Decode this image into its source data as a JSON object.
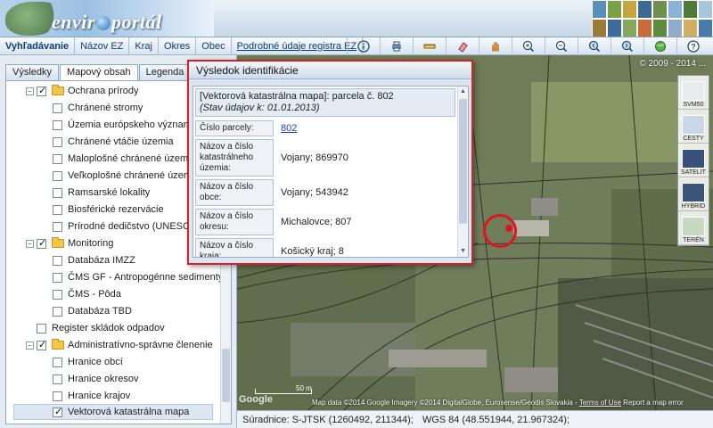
{
  "app": {
    "logo_text_pre": "envir",
    "logo_text_post": "portál"
  },
  "toolbar": {
    "nav": [
      {
        "label": "Vyhľadávanie"
      },
      {
        "label": "Názov EZ"
      },
      {
        "label": "Kraj"
      },
      {
        "label": "Okres"
      },
      {
        "label": "Obec"
      },
      {
        "label": "Podrobné údaje registra EZ"
      }
    ],
    "tools": [
      "info-icon",
      "print-icon",
      "measure-icon",
      "eraser-icon",
      "pan-hand-icon",
      "zoom-in-icon",
      "zoom-out-icon",
      "zoom-prev-icon",
      "zoom-next-icon",
      "full-extent-icon",
      "help-icon"
    ]
  },
  "left_panel": {
    "tabs": [
      {
        "label": "Výsledky",
        "active": false
      },
      {
        "label": "Mapový obsah",
        "active": true
      },
      {
        "label": "Legenda",
        "active": false
      }
    ],
    "tree": [
      {
        "label": "Ochrana prírody",
        "group": true,
        "checked": true
      },
      {
        "label": "Chránené stromy",
        "checked": false
      },
      {
        "label": "Územia európskeho významu",
        "checked": false
      },
      {
        "label": "Chránené vtáčie územia",
        "checked": false
      },
      {
        "label": "Maloplošné chránené územia",
        "checked": false
      },
      {
        "label": "Veľkoplošné chránené územia",
        "checked": false
      },
      {
        "label": "Ramsarské lokality",
        "checked": false
      },
      {
        "label": "Biosférické rezervácie",
        "checked": false
      },
      {
        "label": "Prírodné dedičstvo (UNESCO)",
        "checked": false
      },
      {
        "label": "Monitoring",
        "group": true,
        "checked": true
      },
      {
        "label": "Databáza IMZZ",
        "checked": false
      },
      {
        "label": "ČMS GF - Antropogénne sedimenty",
        "checked": false
      },
      {
        "label": "ČMS - Pôda",
        "checked": false
      },
      {
        "label": "Databáza TBD",
        "checked": false
      },
      {
        "label": "Register skládok odpadov",
        "top": true,
        "checked": false
      },
      {
        "label": "Administratívno-správne členenie",
        "group": true,
        "checked": true
      },
      {
        "label": "Hranice obcí",
        "checked": false
      },
      {
        "label": "Hranice okresov",
        "checked": false
      },
      {
        "label": "Hranice krajov",
        "checked": false
      },
      {
        "label": "Vektorová katastrálna mapa",
        "checked": true,
        "selected": true
      }
    ]
  },
  "map": {
    "copyright": "© 2009 - 2014 ...",
    "map_types": [
      {
        "label": "SVM50",
        "color": "#e8ecef"
      },
      {
        "label": "CESTY",
        "color": "#c9d7e8"
      },
      {
        "label": "SATELIT",
        "color": "#39507a"
      },
      {
        "label": "HYBRID",
        "color": "#3c5479"
      },
      {
        "label": "TERÉN",
        "color": "#c7d8c2"
      }
    ],
    "google_logo": "Google",
    "scale_label": "50 m",
    "attribution_text": "Map data ©2014 Google Imagery ©2014 DigitalGlobe, Eurosense/Geodis Slovakia - ",
    "attribution_terms": "Terms of Use",
    "attribution_report": "Report a map error"
  },
  "statusbar": {
    "sjtsk": "Súradnice: S-JTSK (1260492, 211344);",
    "wgs": "WGS 84 (48.551944, 21.967324);"
  },
  "dialog": {
    "title": "Výsledok identifikácie",
    "header_line": "[Vektorová katastrálna mapa]: parcela č. 802",
    "header_stav": "(Stav údajov k: 01.01.2013)",
    "rows": [
      {
        "label": "Číslo parcely:",
        "value": "802",
        "link": true
      },
      {
        "label": "Názov a číslo katastrálneho územia:",
        "value": "Vojany; 869970"
      },
      {
        "label": "Názov a číslo obce:",
        "value": "Vojany; 543942"
      },
      {
        "label": "Názov a číslo okresu:",
        "value": "Michalovce; 807"
      },
      {
        "label": "Názov a číslo kraja:",
        "value": "Košický kraj; 8"
      }
    ]
  }
}
